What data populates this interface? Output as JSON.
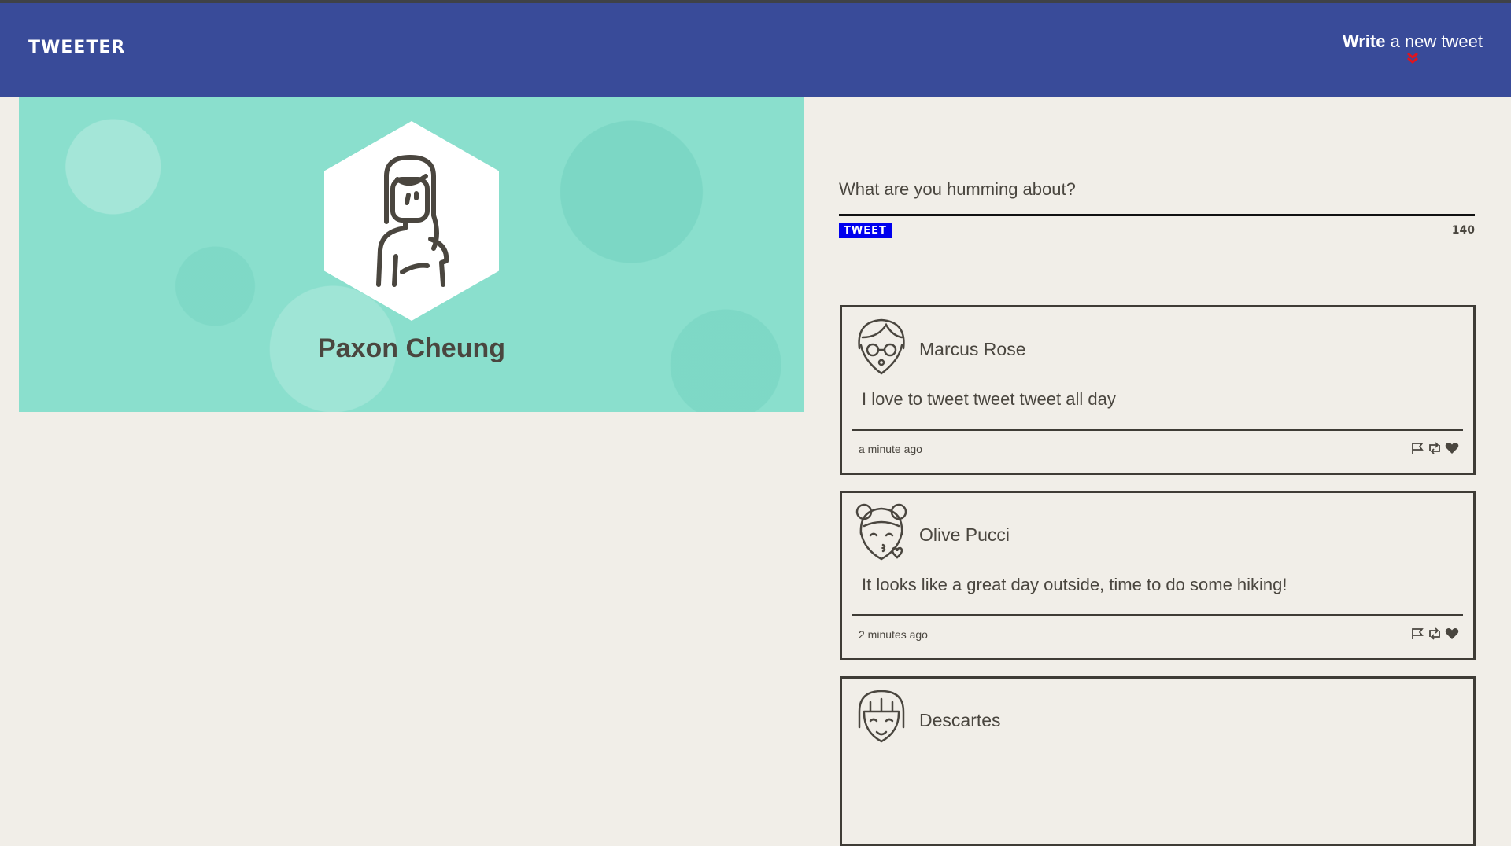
{
  "nav": {
    "brand": "TWEETER",
    "compose_bold": "Write",
    "compose_rest": "a new tweet",
    "accent": "#394b99",
    "chevron_color": "#e0141e"
  },
  "profile": {
    "name": "Paxon Cheung",
    "banner_color": "#8adfcd"
  },
  "composer": {
    "placeholder": "What are you humming about?",
    "button_label": "TWEET",
    "counter": "140",
    "button_color": "#0000ee"
  },
  "tweets": [
    {
      "name": "Marcus Rose",
      "text": "I love to tweet tweet tweet all day",
      "time": "a minute ago",
      "avatar": "glasses-avatar-icon"
    },
    {
      "name": "Olive Pucci",
      "text": "It looks like a great day outside, time to do some hiking!",
      "time": "2 minutes ago",
      "avatar": "buns-avatar-icon"
    },
    {
      "name": "Descartes",
      "text": "",
      "time": "",
      "avatar": "bangs-avatar-icon"
    }
  ],
  "icons": {
    "flag": "flag-icon",
    "retweet": "retweet-icon",
    "like": "heart-icon"
  }
}
